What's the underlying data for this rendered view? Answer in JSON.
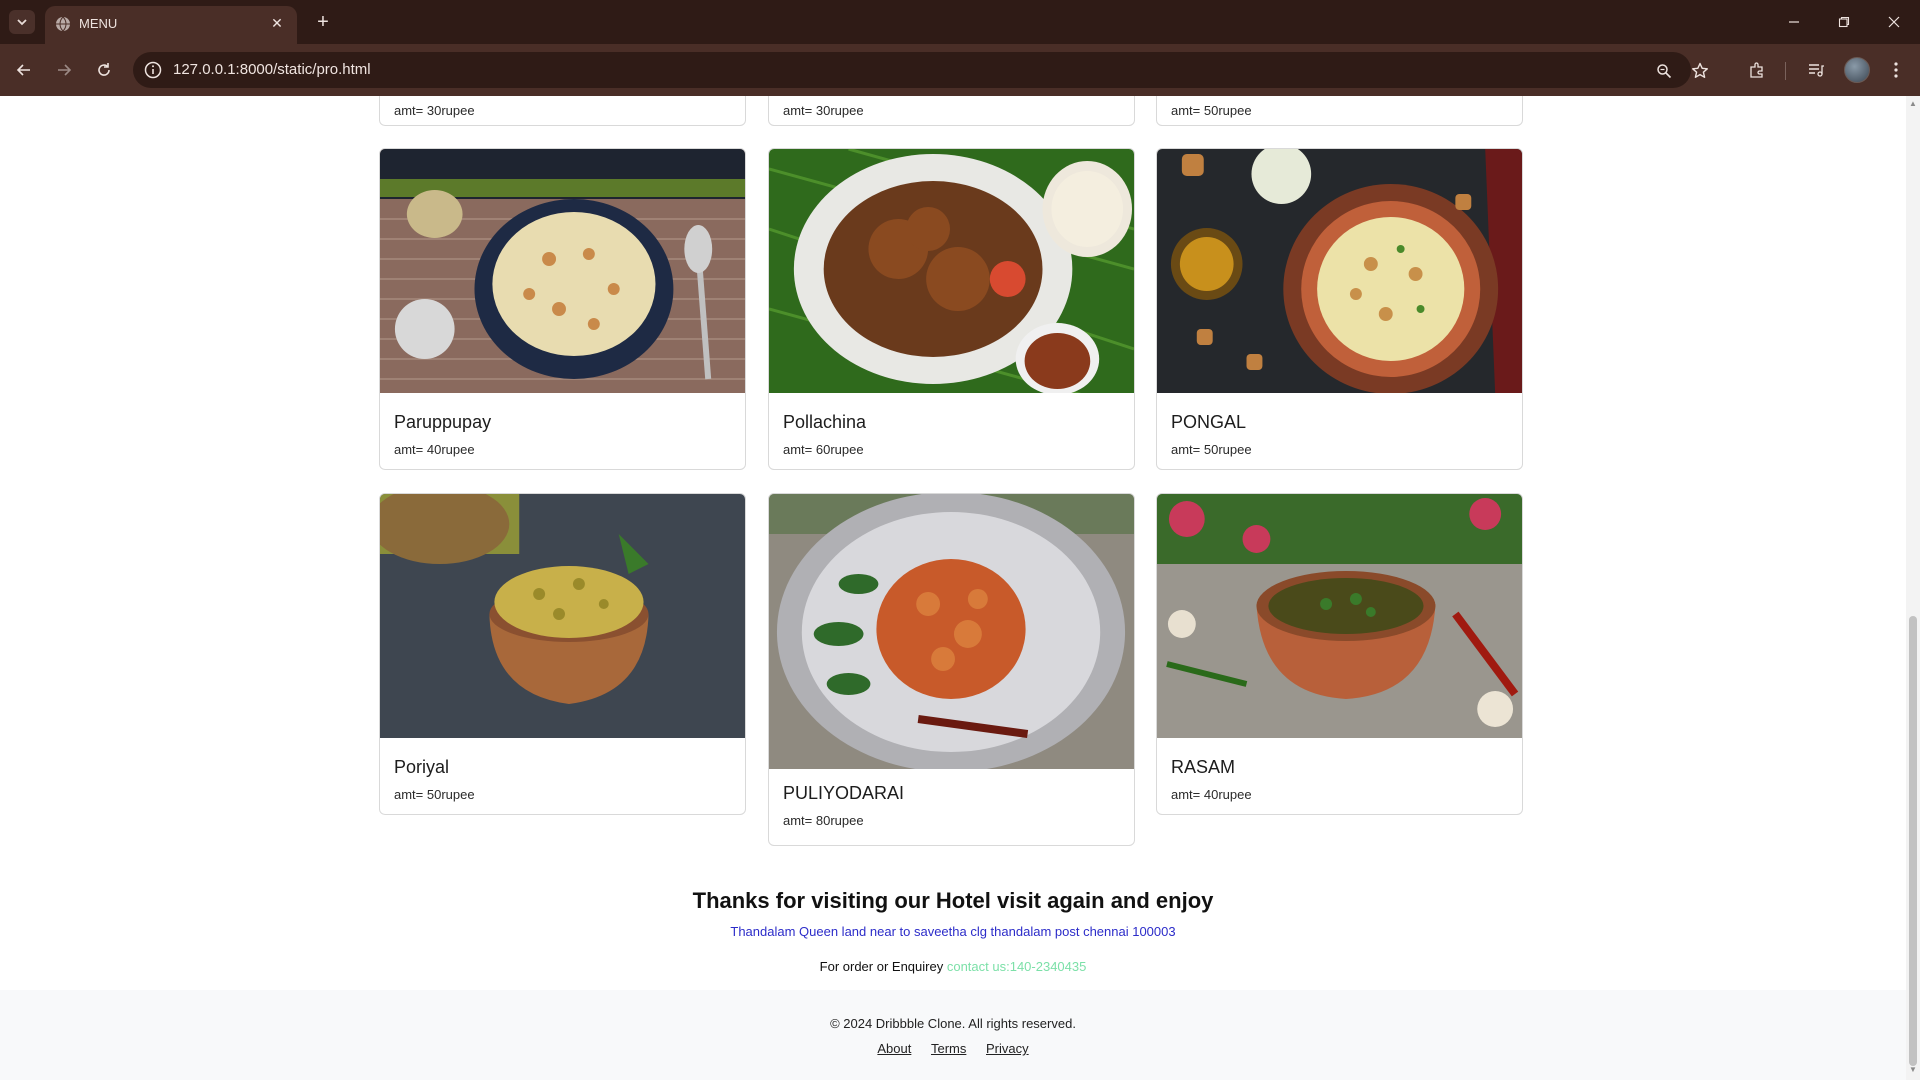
{
  "browser": {
    "tab_title": "MENU",
    "url": "127.0.0.1:8000/static/pro.html"
  },
  "top_row": [
    {
      "price": "amt= 30rupee"
    },
    {
      "price": "amt= 30rupee"
    },
    {
      "price": "amt= 50rupee"
    }
  ],
  "items": [
    {
      "name": "Paruppupay",
      "price": "amt= 40rupee",
      "image": "payasam bowl"
    },
    {
      "name": "Pollachina",
      "price": "amt= 60rupee",
      "image": "crab masala plate"
    },
    {
      "name": "PONGAL",
      "price": "amt= 50rupee",
      "image": "pongal bowl"
    },
    {
      "name": "Poriyal",
      "price": "amt= 50rupee",
      "image": "poriyal clay pot"
    },
    {
      "name": "PULIYODARAI",
      "price": "amt= 80rupee",
      "image": "tamarind rice plate"
    },
    {
      "name": "RASAM",
      "price": "amt= 40rupee",
      "image": "rasam bowl"
    }
  ],
  "message": {
    "thanks": "Thanks for visiting our Hotel visit again and enjoy",
    "address": "Thandalam Queen land near to saveetha clg thandalam post chennai 100003",
    "enquiry_prefix": "For order or Enquirey",
    "contact": "contact us:140-2340435"
  },
  "footer": {
    "copyright": "© 2024 Dribbble Clone. All rights reserved.",
    "links": [
      "About",
      "Terms",
      "Privacy"
    ]
  },
  "colors": {
    "link_blue": "#2c2cc9",
    "contact_green": "#7ce0a8",
    "chrome_dark": "#2f1b16",
    "chrome_toolbar": "#4a2e27"
  }
}
